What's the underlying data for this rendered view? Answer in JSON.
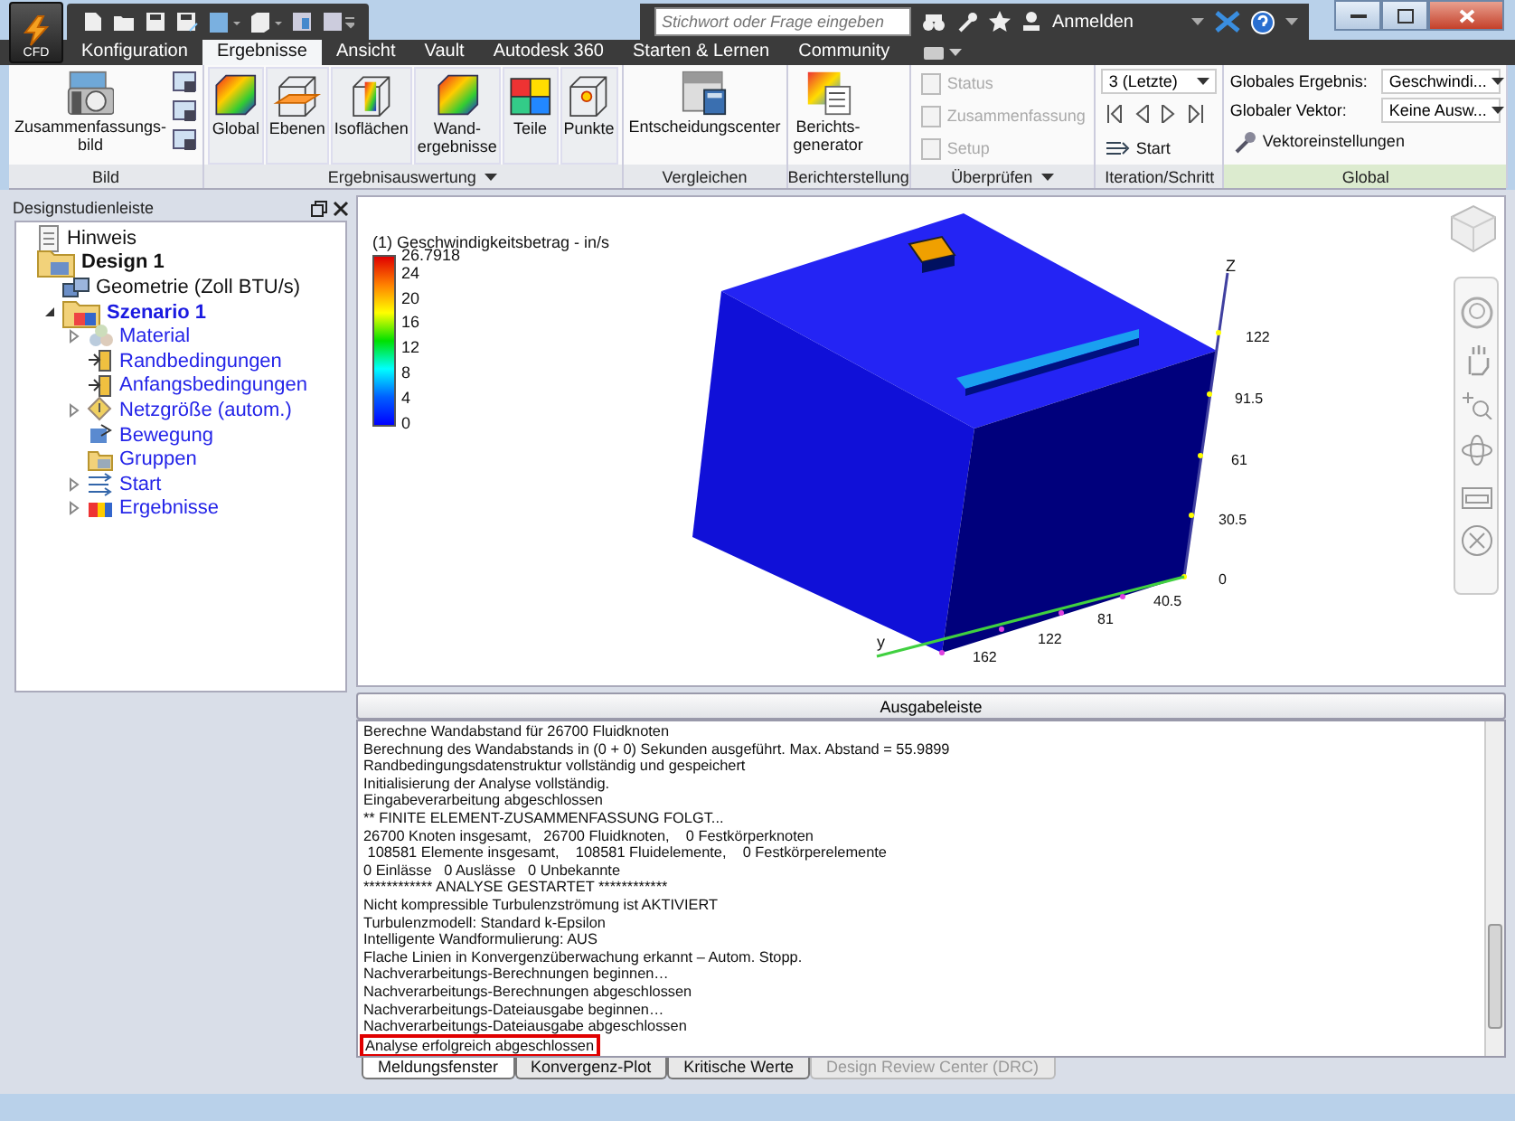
{
  "app_button": {
    "label": "CFD"
  },
  "search": {
    "placeholder": "Stichwort oder Frage eingeben"
  },
  "sign_in": {
    "label": "Anmelden"
  },
  "tabs": [
    {
      "label": "Konfiguration",
      "selected": false
    },
    {
      "label": "Ergebnisse",
      "selected": true
    },
    {
      "label": "Ansicht",
      "selected": false
    },
    {
      "label": "Vault",
      "selected": false
    },
    {
      "label": "Autodesk 360",
      "selected": false
    },
    {
      "label": "Starten & Lernen",
      "selected": false
    },
    {
      "label": "Community",
      "selected": false
    }
  ],
  "ribbon": {
    "groups": [
      {
        "title": "Bild",
        "menu": false,
        "highlighted": false,
        "items": [
          {
            "kind": "large",
            "label": "Zusammenfassungs-\nbild"
          },
          {
            "kind": "icon"
          },
          {
            "kind": "icon"
          },
          {
            "kind": "icon"
          }
        ]
      },
      {
        "title": "Ergebnisauswertung",
        "menu": true,
        "highlighted": false,
        "items": [
          {
            "kind": "large",
            "label": "Global"
          },
          {
            "kind": "large",
            "label": "Ebenen"
          },
          {
            "kind": "large",
            "label": "Isoflächen"
          },
          {
            "kind": "large",
            "label": "Wand-\nergebnisse"
          },
          {
            "kind": "large",
            "label": "Teile"
          },
          {
            "kind": "large",
            "label": "Punkte"
          }
        ]
      },
      {
        "title": "Vergleichen",
        "menu": false,
        "highlighted": false,
        "items": [
          {
            "kind": "large",
            "label": "Entscheidungscenter"
          }
        ]
      },
      {
        "title": "Berichterstellung",
        "menu": false,
        "highlighted": false,
        "items": [
          {
            "kind": "large",
            "label": "Berichts-\ngenerator"
          }
        ]
      },
      {
        "title": "Überprüfen",
        "menu": true,
        "highlighted": false,
        "items": [
          {
            "kind": "small",
            "label": "Status",
            "disabled": true
          },
          {
            "kind": "small",
            "label": "Zusammenfassung",
            "disabled": true
          },
          {
            "kind": "small",
            "label": "Setup",
            "disabled": true
          }
        ]
      },
      {
        "title": "Iteration/Schritt",
        "menu": false,
        "highlighted": false,
        "items": [
          {
            "kind": "dropdown",
            "value": "3 (Letzte)"
          },
          {
            "kind": "stepper"
          },
          {
            "kind": "small",
            "label": "Start",
            "disabled": false
          }
        ]
      },
      {
        "title": "Global",
        "menu": false,
        "highlighted": true,
        "items": [
          {
            "kind": "field",
            "label": "Globales Ergebnis:",
            "value": "Geschwindi..."
          },
          {
            "kind": "field",
            "label": "Globaler Vektor:",
            "value": "Keine Ausw..."
          },
          {
            "kind": "small",
            "label": "Vektoreinstellungen",
            "disabled": false
          }
        ]
      }
    ]
  },
  "sidebar": {
    "title": "Designstudienleiste",
    "items": [
      {
        "label": "Hinweis",
        "kind": "note",
        "expandable": false
      },
      {
        "label": "Design 1",
        "kind": "design",
        "expandable": false,
        "children": [
          {
            "label": "Geometrie (Zoll BTU/s)",
            "kind": "geometry",
            "expandable": false
          },
          {
            "label": "Szenario 1",
            "kind": "scenario",
            "expandable": true,
            "expanded": true,
            "children": [
              {
                "label": "Material",
                "kind": "link",
                "expandable": true,
                "expanded": false
              },
              {
                "label": "Randbedingungen",
                "kind": "link",
                "expandable": false
              },
              {
                "label": "Anfangsbedingungen",
                "kind": "link",
                "expandable": false
              },
              {
                "label": "Netzgröße (autom.)",
                "kind": "link",
                "expandable": true,
                "expanded": false
              },
              {
                "label": "Bewegung",
                "kind": "link",
                "expandable": false
              },
              {
                "label": "Gruppen",
                "kind": "link",
                "expandable": false
              },
              {
                "label": "Start",
                "kind": "link",
                "expandable": true,
                "expanded": false
              },
              {
                "label": "Ergebnisse",
                "kind": "link",
                "expandable": true,
                "expanded": false
              }
            ]
          }
        ]
      }
    ]
  },
  "viewport": {
    "legend": {
      "title": "(1) Geschwindigkeitsbetrag - in/s",
      "ticks": [
        "26.7918",
        "24",
        "20",
        "16",
        "12",
        "8",
        "4",
        "0"
      ]
    },
    "z_axis": {
      "label": "Z",
      "ticks": [
        "122",
        "91.5",
        "61",
        "30.5",
        "0"
      ]
    },
    "x_axis": {
      "ticks": [
        "40.5",
        "81",
        "122",
        "162"
      ]
    },
    "y_axis": {
      "label": "y"
    }
  },
  "output": {
    "title": "Ausgabeleiste",
    "lines": [
      {
        "text": "Berechne Wandabstand für 26700 Fluidknoten",
        "highlighted": false
      },
      {
        "text": "Berechnung des Wandabstands in (0 + 0) Sekunden ausgeführt. Max. Abstand = 55.9899",
        "highlighted": false
      },
      {
        "text": "Randbedingungsdatenstruktur vollständig und gespeichert",
        "highlighted": false
      },
      {
        "text": "Initialisierung der Analyse vollständig.",
        "highlighted": false
      },
      {
        "text": "Eingabeverarbeitung abgeschlossen",
        "highlighted": false
      },
      {
        "text": "** FINITE ELEMENT-ZUSAMMENFASSUNG FOLGT...",
        "highlighted": false
      },
      {
        "text": "26700 Knoten insgesamt,   26700 Fluidknoten,    0 Festkörperknoten",
        "highlighted": false
      },
      {
        "text": " 108581 Elemente insgesamt,    108581 Fluidelemente,    0 Festkörperelemente",
        "highlighted": false
      },
      {
        "text": "0 Einlässe   0 Auslässe   0 Unbekannte",
        "highlighted": false
      },
      {
        "text": "************ ANALYSE GESTARTET ************",
        "highlighted": false
      },
      {
        "text": "Nicht kompressible Turbulenzströmung ist AKTIVIERT",
        "highlighted": false
      },
      {
        "text": "Turbulenzmodell: Standard k-Epsilon",
        "highlighted": false
      },
      {
        "text": "Intelligente Wandformulierung: AUS",
        "highlighted": false
      },
      {
        "text": "Flache Linien in Konvergenzüberwachung erkannt – Autom. Stopp.",
        "highlighted": false
      },
      {
        "text": "Nachverarbeitungs-Berechnungen beginnen…",
        "highlighted": false
      },
      {
        "text": "Nachverarbeitungs-Berechnungen abgeschlossen",
        "highlighted": false
      },
      {
        "text": "Nachverarbeitungs-Dateiausgabe beginnen…",
        "highlighted": false
      },
      {
        "text": "Nachverarbeitungs-Dateiausgabe abgeschlossen",
        "highlighted": false
      },
      {
        "text": "Analyse erfolgreich abgeschlossen",
        "highlighted": true
      }
    ],
    "tabs": [
      {
        "label": "Meldungsfenster",
        "selected": true,
        "disabled": false
      },
      {
        "label": "Konvergenz-Plot",
        "selected": false,
        "disabled": false
      },
      {
        "label": "Kritische Werte",
        "selected": false,
        "disabled": false
      },
      {
        "label": "Design Review Center (DRC)",
        "selected": false,
        "disabled": true
      }
    ]
  }
}
